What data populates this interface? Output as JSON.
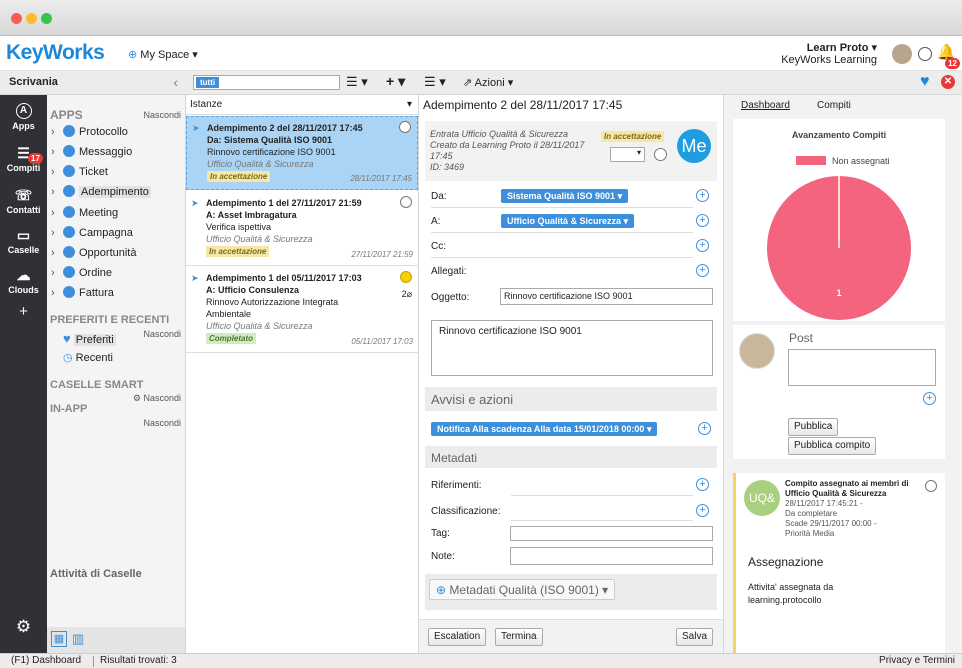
{
  "header": {
    "logo": "KeyWorks",
    "space": "My Space",
    "user_name": "Learn Proto",
    "user_org": "KeyWorks Learning",
    "notif_count": "12"
  },
  "leftbar": {
    "items": [
      {
        "label": "Apps"
      },
      {
        "label": "Compiti",
        "badge": "17"
      },
      {
        "label": "Contatti"
      },
      {
        "label": "Caselle"
      },
      {
        "label": "Clouds"
      }
    ]
  },
  "scrivania": {
    "title": "Scrivania"
  },
  "nav": {
    "apps_title": "APPS",
    "nascondi": "Nascondi",
    "apps": [
      "Protocollo",
      "Messaggio",
      "Ticket",
      "Adempimento",
      "Meeting",
      "Campagna",
      "Opportunità",
      "Ordine",
      "Fattura"
    ],
    "pref_title": "PREFERITI E RECENTI",
    "preferiti": "Preferiti",
    "recenti": "Recenti",
    "smart_title": "CASELLE SMART",
    "inapp_title": "IN-APP",
    "activity_title": "Attività di Caselle"
  },
  "list": {
    "filter_tag": "tutti",
    "sort_label": "Istanze",
    "cards": [
      {
        "title": "Adempimento 2 del 28/11/2017 17:45",
        "sub": "Da: Sistema Qualità ISO 9001",
        "desc": "Rinnovo certificazione ISO 9001",
        "office": "Ufficio Qualità & Sicurezza",
        "status": "In accettazione",
        "date": "28/11/2017 17:45"
      },
      {
        "title": "Adempimento 1 del 27/11/2017 21:59",
        "sub": "A: Asset Imbragatura",
        "desc": "Verifica ispettiva",
        "office": "Ufficio Qualità & Sicurezza",
        "status": "In accettazione",
        "date": "27/11/2017 21:59"
      },
      {
        "title": "Adempimento 1 del 05/11/2017 17:03",
        "sub": "A: Ufficio Consulenza",
        "desc": "Rinnovo Autorizzazione Integrata Ambientale",
        "office": "Ufficio Qualità & Sicurezza",
        "status": "Completato",
        "date": "05/11/2017 17:03",
        "attach": "2"
      }
    ]
  },
  "detail": {
    "actions": "Azioni",
    "title": "Adempimento 2 del 28/11/2017 17:45",
    "meta1": "Entrata Ufficio Qualità & Sicurezza",
    "meta2": "Creato da Learning Proto il 28/11/2017 17:45",
    "meta3": "ID: 3469",
    "status": "In accettazione",
    "avatar": "Me",
    "da_label": "Da:",
    "da_value": "Sistema Qualità ISO 9001",
    "a_label": "A:",
    "a_value": "Ufficio Qualità & Sicurezza",
    "cc_label": "Cc:",
    "allegati_label": "Allegati:",
    "oggetto_label": "Oggetto:",
    "oggetto_value": "Rinnovo certificazione ISO 9001",
    "body": "Rinnovo certificazione ISO 9001",
    "avvisi_title": "Avvisi e azioni",
    "notifica": "Notifica Alla scadenza Alla data 15/01/2018 00:00",
    "metadati_title": "Metadati",
    "riferimenti": "Riferimenti:",
    "classificazione": "Classificazione:",
    "tag": "Tag:",
    "note": "Note:",
    "metaq": "Metadati Qualità (ISO 9001)",
    "escalation": "Escalation",
    "termina": "Termina",
    "salva": "Salva"
  },
  "right": {
    "tab_dashboard": "Dashboard",
    "tab_compiti": "Compiti",
    "chart_title": "Avanzamento Compiti",
    "post_label": "Post",
    "pubblica": "Pubblica",
    "pubblica_compito": "Pubblica compito",
    "task_avatar": "UQ&",
    "task_title": "Compito assegnato ai membri di Ufficio Qualità & Sicurezza",
    "task_date": "28/11/2017 17:45:21 -",
    "task_status": "Da completare",
    "task_due": "Scade 29/11/2017 00:00 -",
    "task_priority": "Priorità Media",
    "assign_title": "Assegnazione",
    "assign_text": "Attivita' assegnata da learning.protocollo"
  },
  "chart_data": {
    "type": "pie",
    "title": "Avanzamento Compiti",
    "categories": [
      "Non assegnati"
    ],
    "values": [
      1
    ],
    "colors": [
      "#f4647e"
    ],
    "legend": "top"
  },
  "status": {
    "help": "(F1) Dashboard",
    "results": "Risultati trovati: 3",
    "privacy": "Privacy e Termini"
  }
}
